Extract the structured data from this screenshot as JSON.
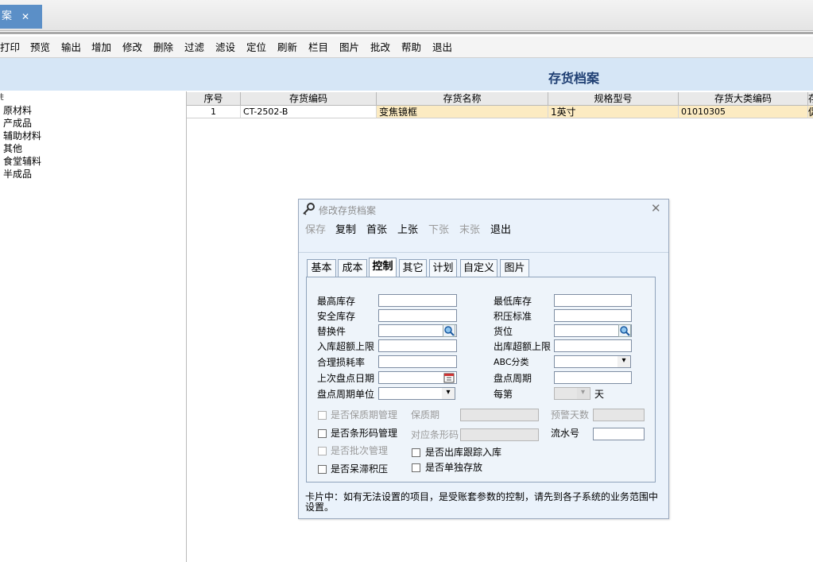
{
  "tab": {
    "label": "案",
    "close": "✕"
  },
  "toolbar": [
    "打印",
    "预览",
    "输出",
    "增加",
    "修改",
    "删除",
    "过滤",
    "滤设",
    "定位",
    "刷新",
    "栏目",
    "图片",
    "批改",
    "帮助",
    "退出"
  ],
  "page_title": "存货档案",
  "tree": {
    "truncated_top": "ŧ",
    "items": [
      "原材料",
      "产成品",
      "辅助材料",
      "其他",
      "食堂辅料",
      "半成品"
    ]
  },
  "grid": {
    "headers": [
      "序号",
      "存货编码",
      "存货名称",
      "规格型号",
      "存货大类编码",
      "存"
    ],
    "row": [
      "1",
      "CT-2502-B",
      "变焦镜框",
      "1英寸",
      "01010305",
      "促"
    ]
  },
  "dialog": {
    "title": "修改存货档案",
    "close": "✕",
    "toolbar": [
      {
        "label": "保存",
        "enabled": false
      },
      {
        "label": "复制",
        "enabled": true
      },
      {
        "label": "首张",
        "enabled": true
      },
      {
        "label": "上张",
        "enabled": true
      },
      {
        "label": "下张",
        "enabled": false
      },
      {
        "label": "末张",
        "enabled": false
      },
      {
        "label": "退出",
        "enabled": true
      }
    ],
    "tabs": [
      "基本",
      "成本",
      "控制",
      "其它",
      "计划",
      "自定义",
      "图片"
    ],
    "active_tab": "控制",
    "fields": {
      "max_stock": {
        "label": "最高库存",
        "value": ""
      },
      "min_stock": {
        "label": "最低库存",
        "value": ""
      },
      "safety_stock": {
        "label": "安全库存",
        "value": ""
      },
      "overstock_std": {
        "label": "积压标准",
        "value": ""
      },
      "substitute": {
        "label": "替换件",
        "value": ""
      },
      "location": {
        "label": "货位",
        "value": ""
      },
      "in_over_limit": {
        "label": "入库超额上限",
        "value": ""
      },
      "out_over_limit": {
        "label": "出库超额上限",
        "value": ""
      },
      "loss_rate": {
        "label": "合理损耗率",
        "value": ""
      },
      "abc_class": {
        "label": "ABC分类",
        "value": ""
      },
      "last_count_date": {
        "label": "上次盘点日期",
        "value": ""
      },
      "count_cycle": {
        "label": "盘点周期",
        "value": ""
      },
      "count_cycle_unit": {
        "label": "盘点周期单位",
        "value": ""
      },
      "every": {
        "label": "每第",
        "value": "",
        "suffix": "天"
      },
      "shelf_life": {
        "label": "保质期",
        "value": ""
      },
      "warn_days": {
        "label": "预警天数",
        "value": ""
      },
      "barcode": {
        "label": "对应条形码",
        "value": ""
      },
      "serial_no": {
        "label": "流水号",
        "value": ""
      }
    },
    "checks": {
      "shelf_mgmt": {
        "label": "是否保质期管理",
        "checked": false,
        "enabled": false
      },
      "barcode_mgmt": {
        "label": "是否条形码管理",
        "checked": false,
        "enabled": true
      },
      "batch_mgmt": {
        "label": "是否批次管理",
        "checked": false,
        "enabled": false
      },
      "out_track": {
        "label": "是否出库跟踪入库",
        "checked": false,
        "enabled": true
      },
      "stagnant": {
        "label": "是否呆滞积压",
        "checked": false,
        "enabled": true
      },
      "single_store": {
        "label": "是否单独存放",
        "checked": false,
        "enabled": true
      }
    },
    "note": "卡片中：如有无法设置的项目，是受账套参数的控制，请先到各子系统的业务范围中设置。"
  },
  "icons": {
    "search": "search-icon",
    "calendar": "calendar-icon",
    "key": "key-icon"
  },
  "colors": {
    "tab_active": "#5b8fc7",
    "header_band": "#d6e6f6",
    "title": "#1f3f73",
    "row_highlight": "#fcebc2"
  }
}
